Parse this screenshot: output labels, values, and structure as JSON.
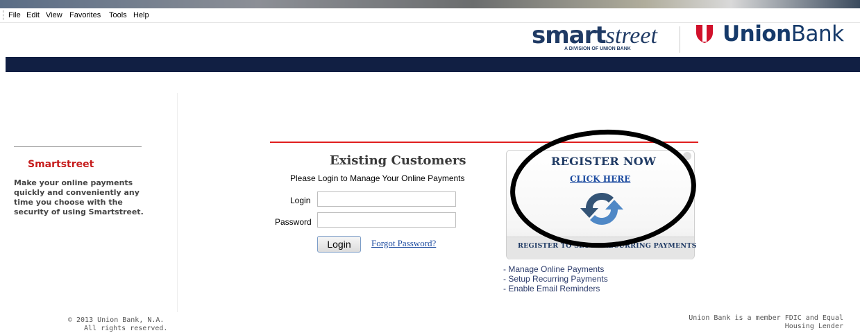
{
  "menu": [
    "File",
    "Edit",
    "View",
    "Favorites",
    "Tools",
    "Help"
  ],
  "logos": {
    "smart": "smart",
    "street": "street",
    "division": "A DIVISION OF UNION BANK",
    "union": "Union",
    "bank": "Bank"
  },
  "sidebar": {
    "title": "Smartstreet",
    "text": "Make your online payments quickly and conveniently any time you choose with the security of using Smartstreet."
  },
  "login": {
    "title": "Existing Customers",
    "subtitle": "Please Login to Manage Your Online Payments",
    "login_label": "Login",
    "password_label": "Password",
    "login_value": "",
    "password_value": "",
    "button": "Login",
    "forgot": "Forgot Password?"
  },
  "register": {
    "title": "REGISTER NOW",
    "link": "CLICK HERE",
    "footer": "REGISTER TO SETUP RECURRING PAYMENTS",
    "icon": "refresh-arrows-icon"
  },
  "features": [
    "- Manage Online Payments",
    "- Setup Recurring Payments",
    "- Enable Email Reminders"
  ],
  "footer": {
    "copyright_1": "© 2013 Union Bank, N.A.",
    "copyright_2": "All rights reserved.",
    "fdic_1": "Union Bank is a member FDIC and Equal",
    "fdic_2": "Housing Lender"
  },
  "colors": {
    "navy": "#111f43",
    "red_accent": "#e01e1e",
    "brand_blue": "#1f3a64",
    "link_blue": "#1c4ba0",
    "annotation": "#000000"
  }
}
